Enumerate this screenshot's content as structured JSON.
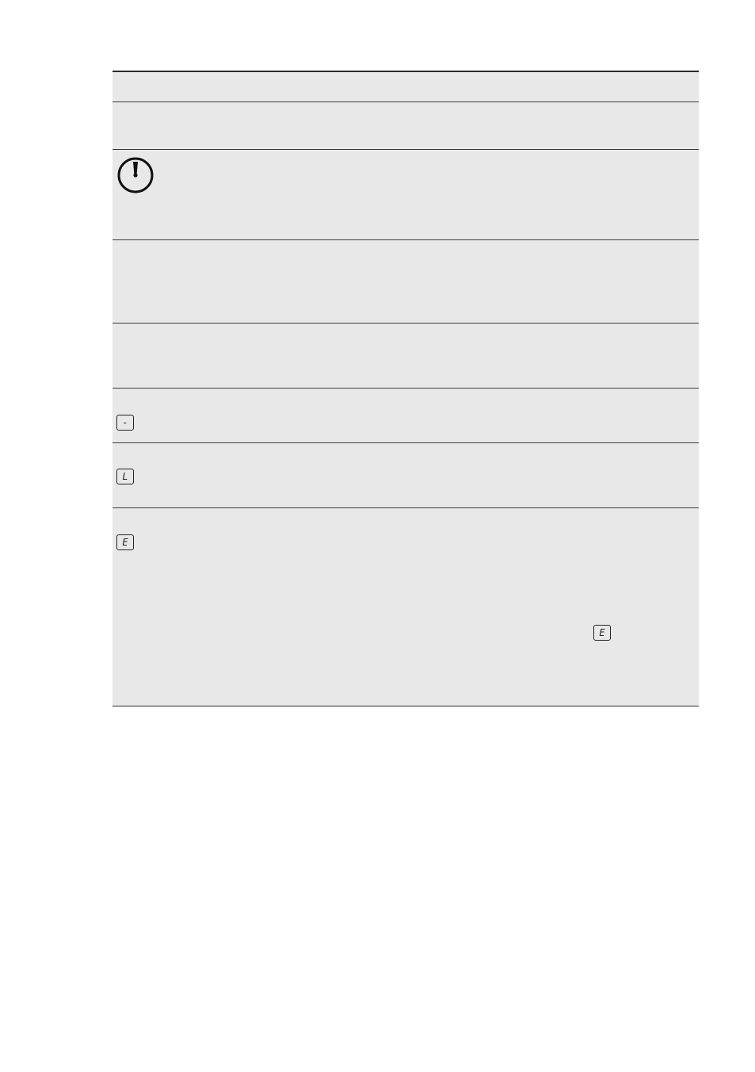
{
  "table": {
    "rows": [
      {
        "name": "row-header",
        "icon": null
      },
      {
        "name": "row-1",
        "icon": null
      },
      {
        "name": "row-2",
        "icon": "timer-icon"
      },
      {
        "name": "row-3",
        "icon": null
      },
      {
        "name": "row-4",
        "icon": null
      },
      {
        "name": "row-5",
        "icon": "display-dash-icon",
        "symbol": "-"
      },
      {
        "name": "row-6",
        "icon": "display-l-icon",
        "symbol": "L"
      },
      {
        "name": "row-7",
        "icon": "display-e-icon",
        "symbol": "E",
        "inline_symbol": "E"
      }
    ]
  },
  "colors": {
    "row_background": "#e8e8e8",
    "rule": "#2b2b2b"
  }
}
